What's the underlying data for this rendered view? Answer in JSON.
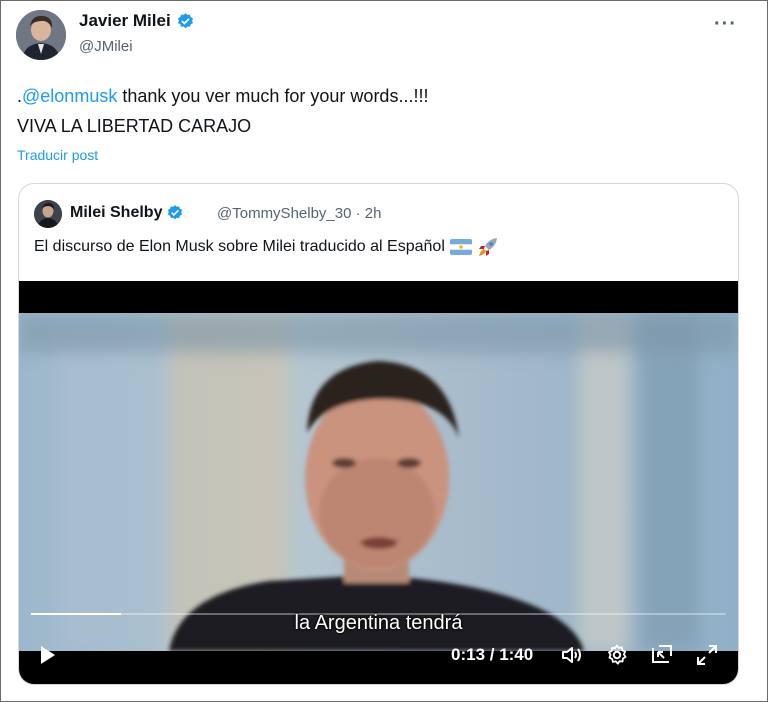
{
  "post": {
    "author_name": "Javier Milei",
    "author_handle": "@JMilei",
    "more_label": "···",
    "text_line1_prefix": ".",
    "mention": "@elonmusk",
    "text_line1_rest": " thank you ver much for your words...!!!",
    "text_line2": "VIVA LA LIBERTAD CARAJO",
    "translate_label": "Traducir post"
  },
  "quote": {
    "author_name": "Milei Shelby",
    "author_handle": "@TommyShelby_30",
    "separator": "·",
    "time": "2h",
    "text": "El discurso de Elon Musk sobre Milei traducido al Español",
    "emojis": [
      "argentina-flag",
      "rocket"
    ]
  },
  "video": {
    "subtitle": "la Argentina tendrá",
    "current_time": "0:13",
    "duration": "1:40",
    "time_display": "0:13 / 1:40",
    "progress": 0.13
  },
  "colors": {
    "accent": "#1d9bf0",
    "text": "#0f1419",
    "muted": "#536471"
  }
}
